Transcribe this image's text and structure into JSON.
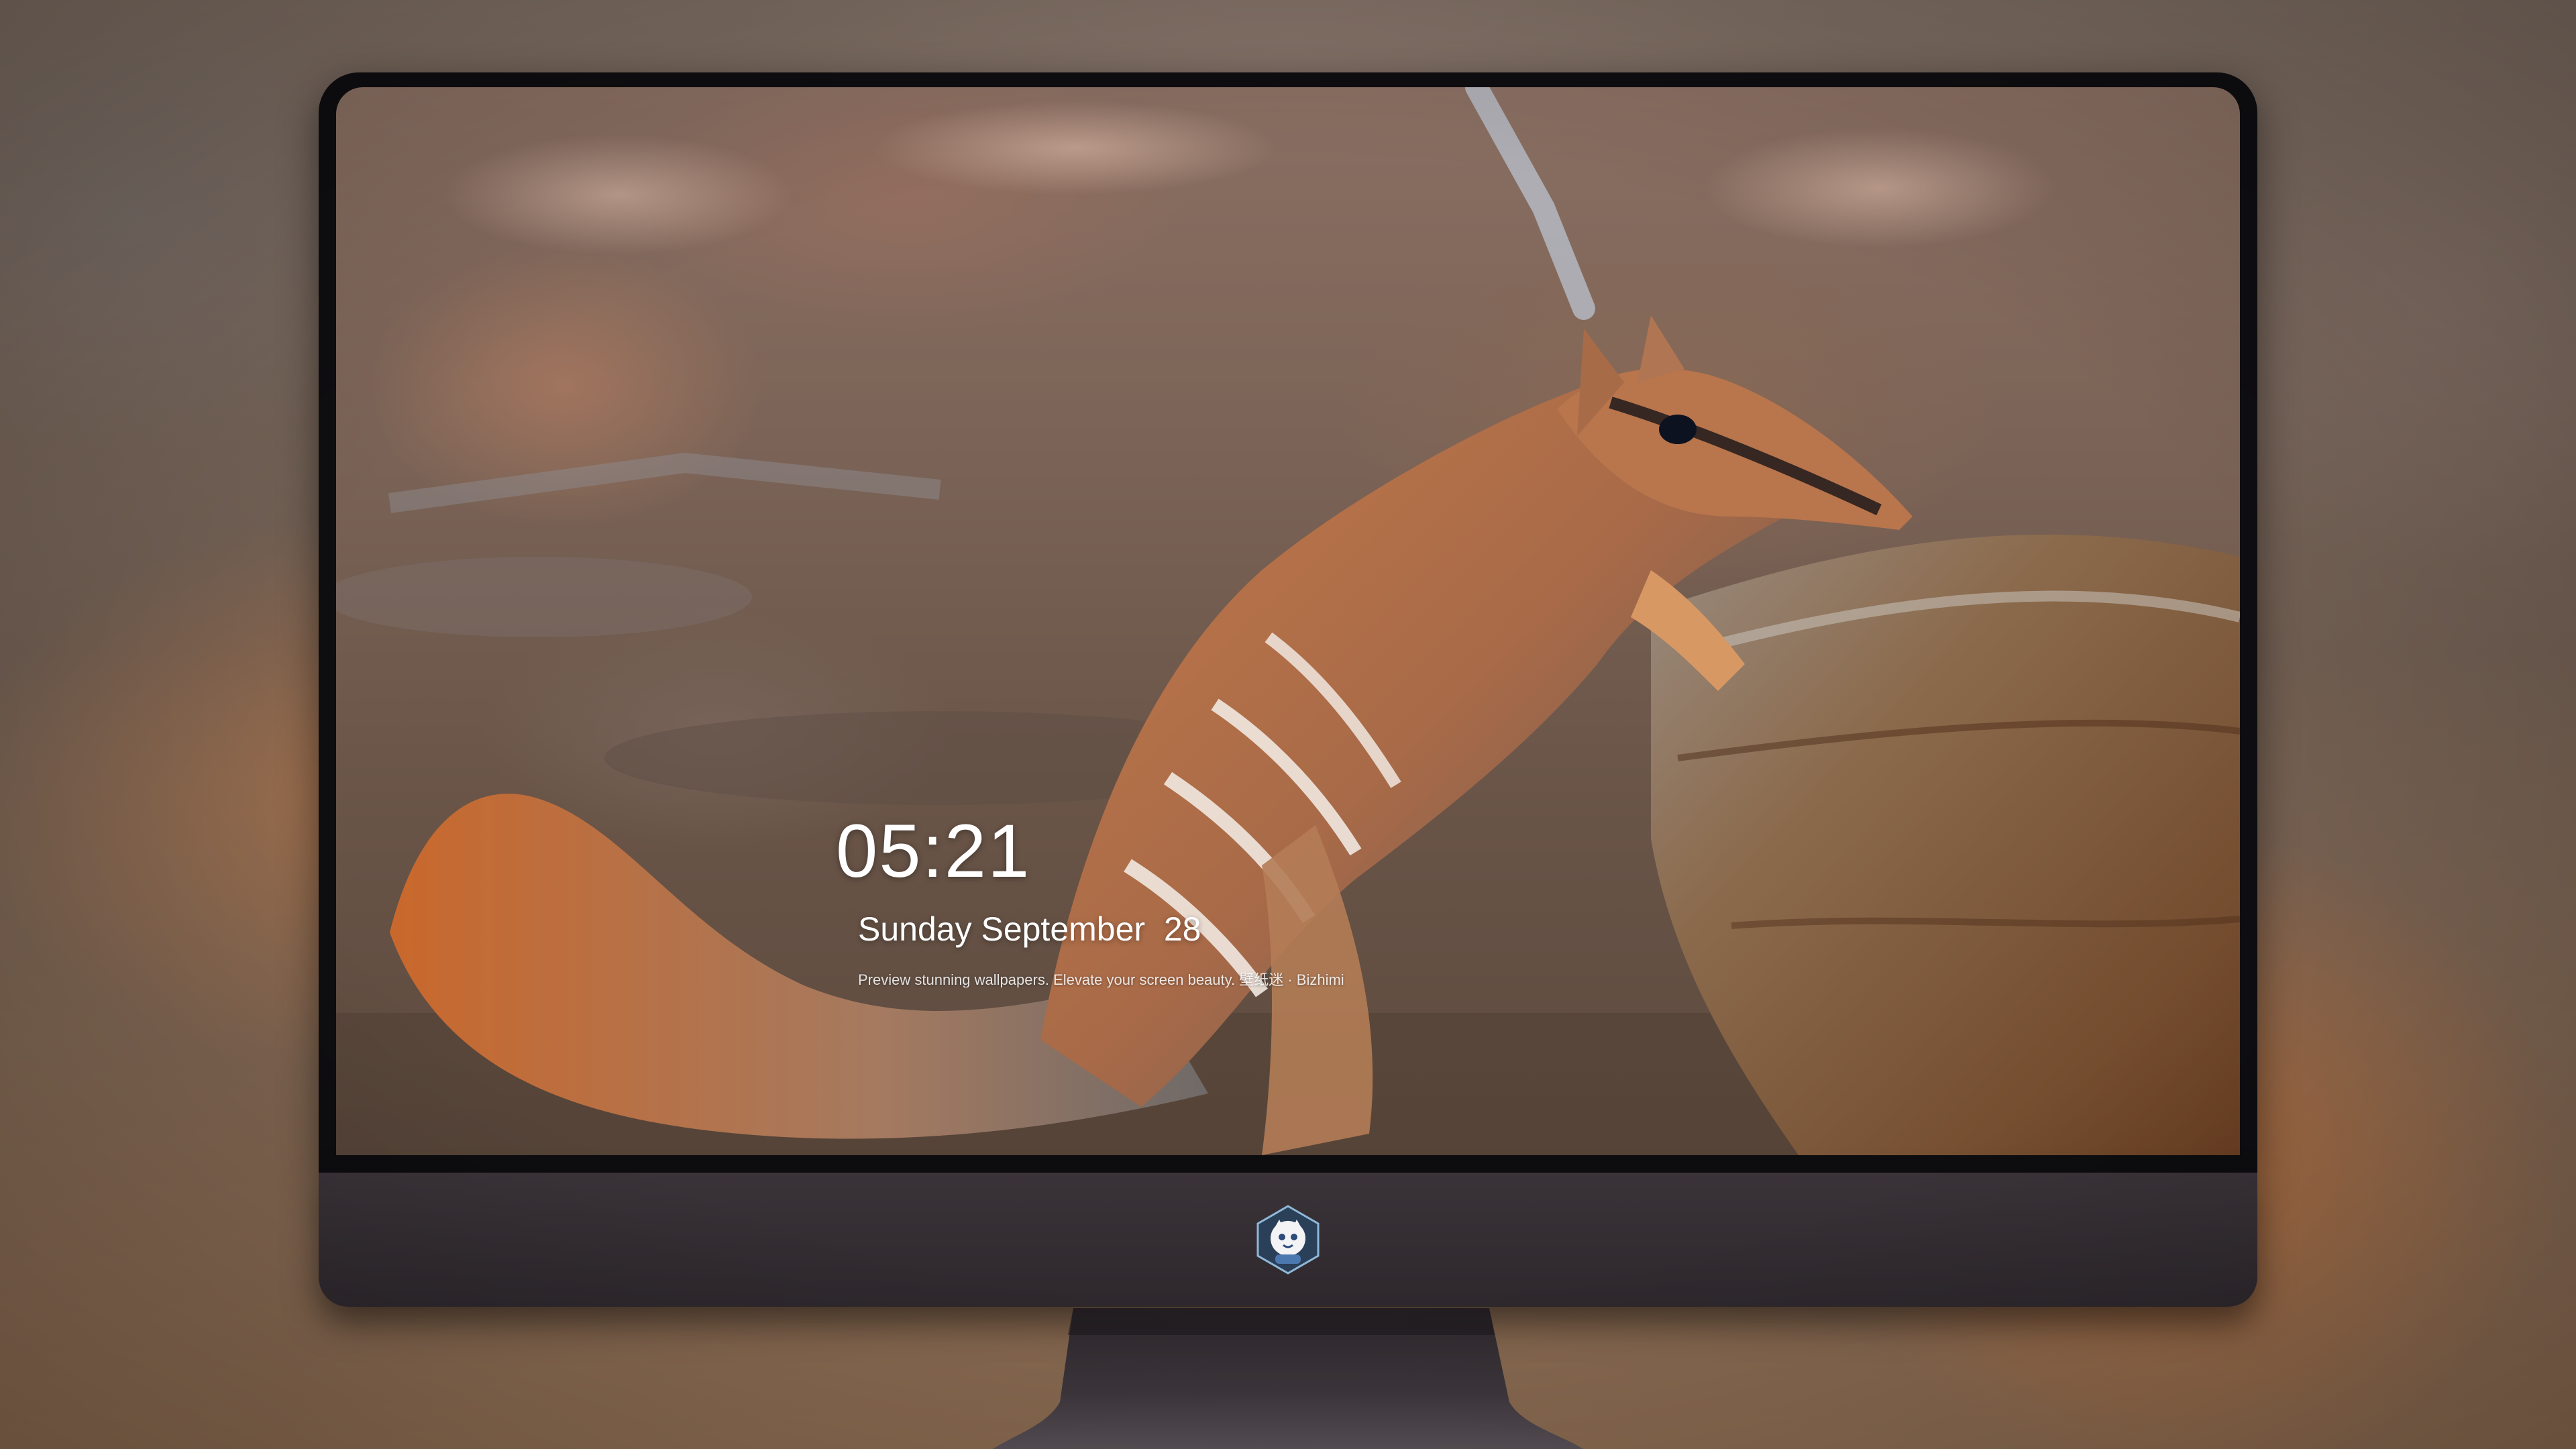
{
  "lock_screen": {
    "time": "05:21",
    "date": "Sunday September  28",
    "caption": "Preview stunning wallpapers. Elevate your screen beauty. 壁纸迷 · Bizhimi"
  },
  "dock": {
    "apps": [
      {
        "name": "messages-icon",
        "color": "#34c759"
      },
      {
        "name": "weather-icon",
        "color": "#2f8cf0"
      },
      {
        "name": "clock-icon",
        "color": "#1c1c1e"
      },
      {
        "name": "preview-icon",
        "color": "#f2b233"
      },
      {
        "name": "clips-icon",
        "color": "#5ac8fa"
      },
      {
        "name": "notes-icon",
        "color": "#ffd43b"
      },
      {
        "name": "photo-booth-icon",
        "color": "#ffffff"
      },
      {
        "name": "music-icon",
        "color": "#fc3c8d"
      },
      {
        "name": "app-store-icon",
        "color": "#1e90ff"
      },
      {
        "name": "screenshot-icon",
        "color": "#8e8e93"
      }
    ]
  },
  "monitor": {
    "logo": "mascot-logo-icon"
  }
}
